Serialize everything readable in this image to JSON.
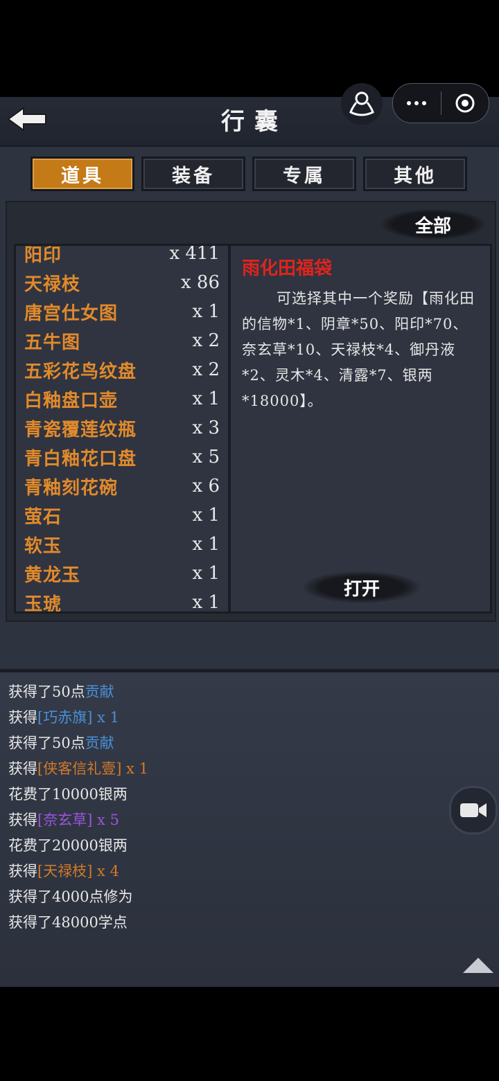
{
  "header": {
    "title": "行囊"
  },
  "tabs": [
    {
      "label": "道具",
      "active": true
    },
    {
      "label": "装备",
      "active": false
    },
    {
      "label": "专属",
      "active": false
    },
    {
      "label": "其他",
      "active": false
    }
  ],
  "filter": {
    "label": "全部"
  },
  "items": [
    {
      "name": "阳印",
      "qty": "x 411"
    },
    {
      "name": "天禄枝",
      "qty": "x 86"
    },
    {
      "name": "唐宫仕女图",
      "qty": "x 1"
    },
    {
      "name": "五牛图",
      "qty": "x 2"
    },
    {
      "name": "五彩花鸟纹盘",
      "qty": "x 2"
    },
    {
      "name": "白釉盘口壶",
      "qty": "x 1"
    },
    {
      "name": "青瓷覆莲纹瓶",
      "qty": "x 3"
    },
    {
      "name": "青白釉花口盘",
      "qty": "x 5"
    },
    {
      "name": "青釉刻花碗",
      "qty": "x 6"
    },
    {
      "name": "萤石",
      "qty": "x 1"
    },
    {
      "name": "软玉",
      "qty": "x 1"
    },
    {
      "name": "黄龙玉",
      "qty": "x 1"
    },
    {
      "name": "玉琥",
      "qty": "x 1"
    }
  ],
  "detail": {
    "title": "雨化田福袋",
    "description": "可选择其中一个奖励【雨化田的信物*1、阴章*50、阳印*70、奈玄草*10、天禄枝*4、御丹液*2、灵木*4、清露*7、银两*18000】。",
    "open_label": "打开"
  },
  "log": [
    {
      "prefix": "获得了50点",
      "highlight": "贡献",
      "color": "blue",
      "suffix": ""
    },
    {
      "prefix": "获得",
      "highlight": "[巧赤旗] x 1",
      "color": "blue",
      "suffix": ""
    },
    {
      "prefix": "获得了50点",
      "highlight": "贡献",
      "color": "blue",
      "suffix": ""
    },
    {
      "prefix": "获得",
      "highlight": "[侠客信礼壹] x 1",
      "color": "orange",
      "suffix": ""
    },
    {
      "prefix": "花费了10000银两",
      "highlight": "",
      "color": "",
      "suffix": ""
    },
    {
      "prefix": "获得",
      "highlight": "[奈玄草] x 5",
      "color": "purple",
      "suffix": ""
    },
    {
      "prefix": "花费了20000银两",
      "highlight": "",
      "color": "",
      "suffix": ""
    },
    {
      "prefix": "获得",
      "highlight": "[天禄枝] x 4",
      "color": "orange",
      "suffix": ""
    },
    {
      "prefix": "获得了4000点修为",
      "highlight": "",
      "color": "",
      "suffix": ""
    },
    {
      "prefix": "获得了48000学点",
      "highlight": "",
      "color": "",
      "suffix": ""
    }
  ],
  "icons": {
    "back": "back-arrow-icon",
    "profile": "person-icon",
    "more": "more-dots-icon",
    "close": "target-icon",
    "camera": "camera-icon",
    "scroll_up": "triangle-up-icon"
  }
}
